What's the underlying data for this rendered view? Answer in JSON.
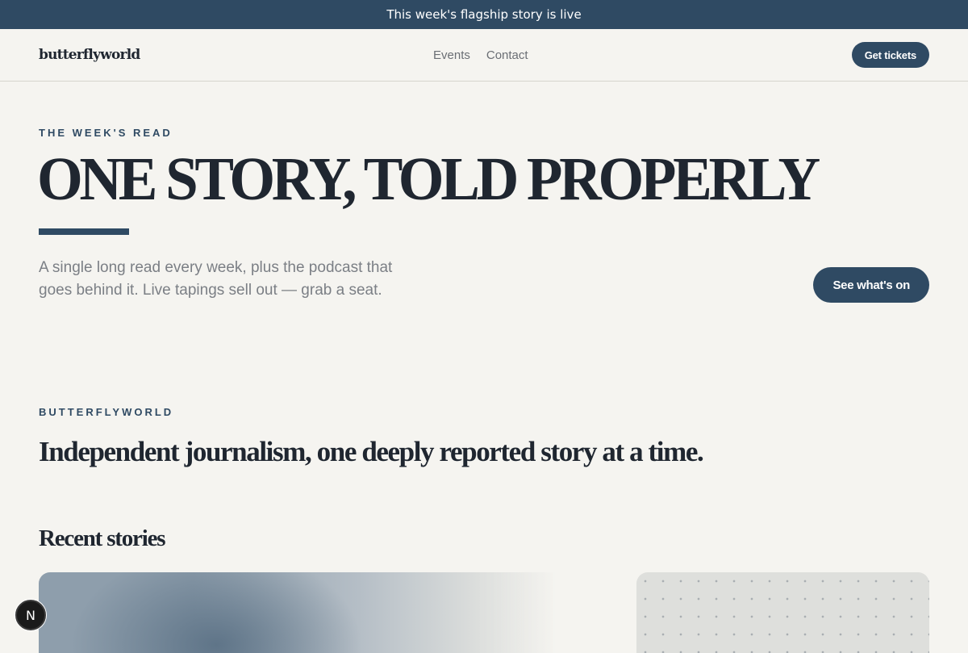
{
  "announcement": {
    "text": "This week's flagship story is live"
  },
  "header": {
    "logo": "butterflyworld",
    "nav": [
      {
        "label": "Events"
      },
      {
        "label": "Contact"
      }
    ],
    "cta_label": "Get tickets"
  },
  "hero": {
    "eyebrow": "THE WEEK'S READ",
    "title": "ONE STORY, TOLD PROPERLY",
    "subtitle": "A single long read every week, plus the podcast that goes behind it. Live tapings sell out — grab a seat.",
    "cta_label": "See what's on"
  },
  "about": {
    "eyebrow": "BUTTERFLYWORLD",
    "tagline": "Independent journalism, one deeply reported story at a time."
  },
  "recent": {
    "title": "Recent stories"
  },
  "badge": {
    "letter": "N"
  },
  "colors": {
    "accent": "#2f4a63",
    "background": "#f5f4f0",
    "text": "#1f2630",
    "muted": "#7b7f85"
  }
}
